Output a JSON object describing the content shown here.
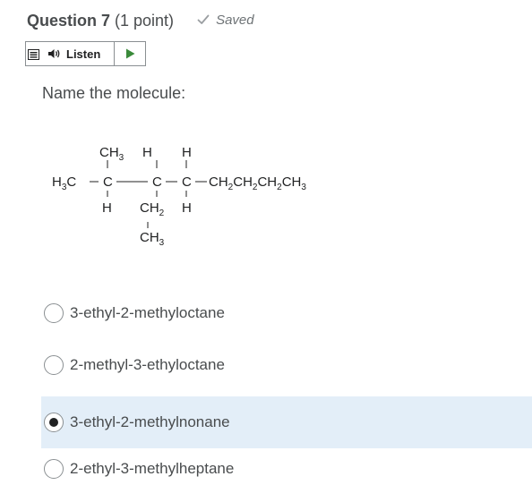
{
  "question": {
    "title": "Question 7",
    "points": "(1 point)",
    "saved_label": "Saved"
  },
  "listen_bar": {
    "listen_label": "Listen"
  },
  "prompt": "Name the molecule:",
  "molecule": {
    "labels": {
      "h3c": "H",
      "h3c_sub": "3",
      "h3c_c": "C",
      "c": "C",
      "ch3": "CH",
      "sub3": "3",
      "h": "H",
      "ch": "CH",
      "sub2": "2",
      "chain": [
        "CH",
        "2",
        "CH",
        "2",
        "CH",
        "2",
        "CH",
        "3"
      ]
    }
  },
  "choices": [
    {
      "label": "3-ethyl-2-methyloctane",
      "selected": false
    },
    {
      "label": "2-methyl-3-ethyloctane",
      "selected": false
    },
    {
      "label": "3-ethyl-2-methylnonane",
      "selected": true
    },
    {
      "label": "2-ethyl-3-methylheptane",
      "selected": false
    }
  ],
  "colors": {
    "selected_background": "#e3eef8",
    "play_green": "#3a8a3a",
    "text": "#494c4e"
  }
}
